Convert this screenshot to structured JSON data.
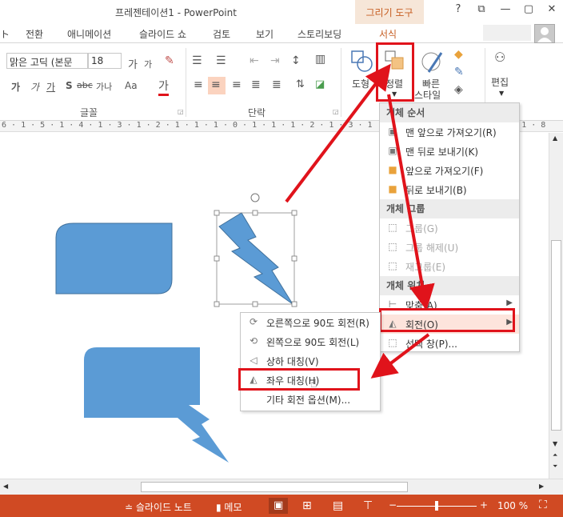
{
  "window": {
    "title": "프레젠테이션1 - PowerPoint",
    "context_group": "그리기 도구",
    "help": "?",
    "restore": "⧉",
    "minimize": "—",
    "maximize": "▢",
    "close": "✕"
  },
  "tabs": [
    "전환",
    "애니메이션",
    "슬라이드 쇼",
    "검토",
    "보기",
    "스토리보딩",
    "서식"
  ],
  "ribbon": {
    "font_name": "맑은 고딕 (본문",
    "font_size": "18",
    "grow": "가",
    "shrink": "가",
    "bold": "가",
    "italic": "가",
    "underline": "가",
    "shadow": "S",
    "strike": "abc",
    "spacing": "가나",
    "case": "Aa",
    "font_color": "가",
    "group_font": "글꼴",
    "group_paragraph": "단락",
    "shapes_label": "도형",
    "arrange_label": "정렬",
    "quick_styles_label_1": "빠른",
    "quick_styles_label_2": "스타일",
    "edit_label": "편집"
  },
  "ruler": "6 · 1 · 5 · 1 · 4 · 1 · 3 · 1 · 2 · 1 · 1 · 1 · 0 · 1 · 1 · 1 · 2 · 1 · 3 · 1 · 4 · 1 · 5 · 1 · 6 · 1 · 7 · 1 · 8",
  "arrange_menu": {
    "header_order": "개체 순서",
    "bring_front": "맨 앞으로 가져오기(R)",
    "send_back": "맨 뒤로 보내기(K)",
    "bring_forward": "앞으로 가져오기(F)",
    "send_backward": "뒤로 보내기(B)",
    "header_group": "개체 그룹",
    "group": "그룹(G)",
    "ungroup": "그룹 해제(U)",
    "regroup": "재그룹(E)",
    "header_position": "개체 위치",
    "align": "맞춤(A)",
    "rotate": "회전(O)",
    "selection_pane": "선택 창(P)..."
  },
  "rotate_menu": {
    "rotate_right": "오른쪽으로 90도 회전(R)",
    "rotate_left": "왼쪽으로 90도 회전(L)",
    "flip_vertical": "상하 대칭(V)",
    "flip_horizontal": "좌우 대칭(H)",
    "more_options": "기타 회전 옵션(M)..."
  },
  "status": {
    "notes": "≐ 슬라이드 노트",
    "comments": "▮ 메모",
    "zoom": "100 %",
    "minus": "−",
    "plus": "+"
  },
  "colors": {
    "accent": "#d04a23",
    "highlight_box": "#e0131b",
    "shape_fill": "#5b9bd5",
    "shape_stroke": "#41719c"
  }
}
